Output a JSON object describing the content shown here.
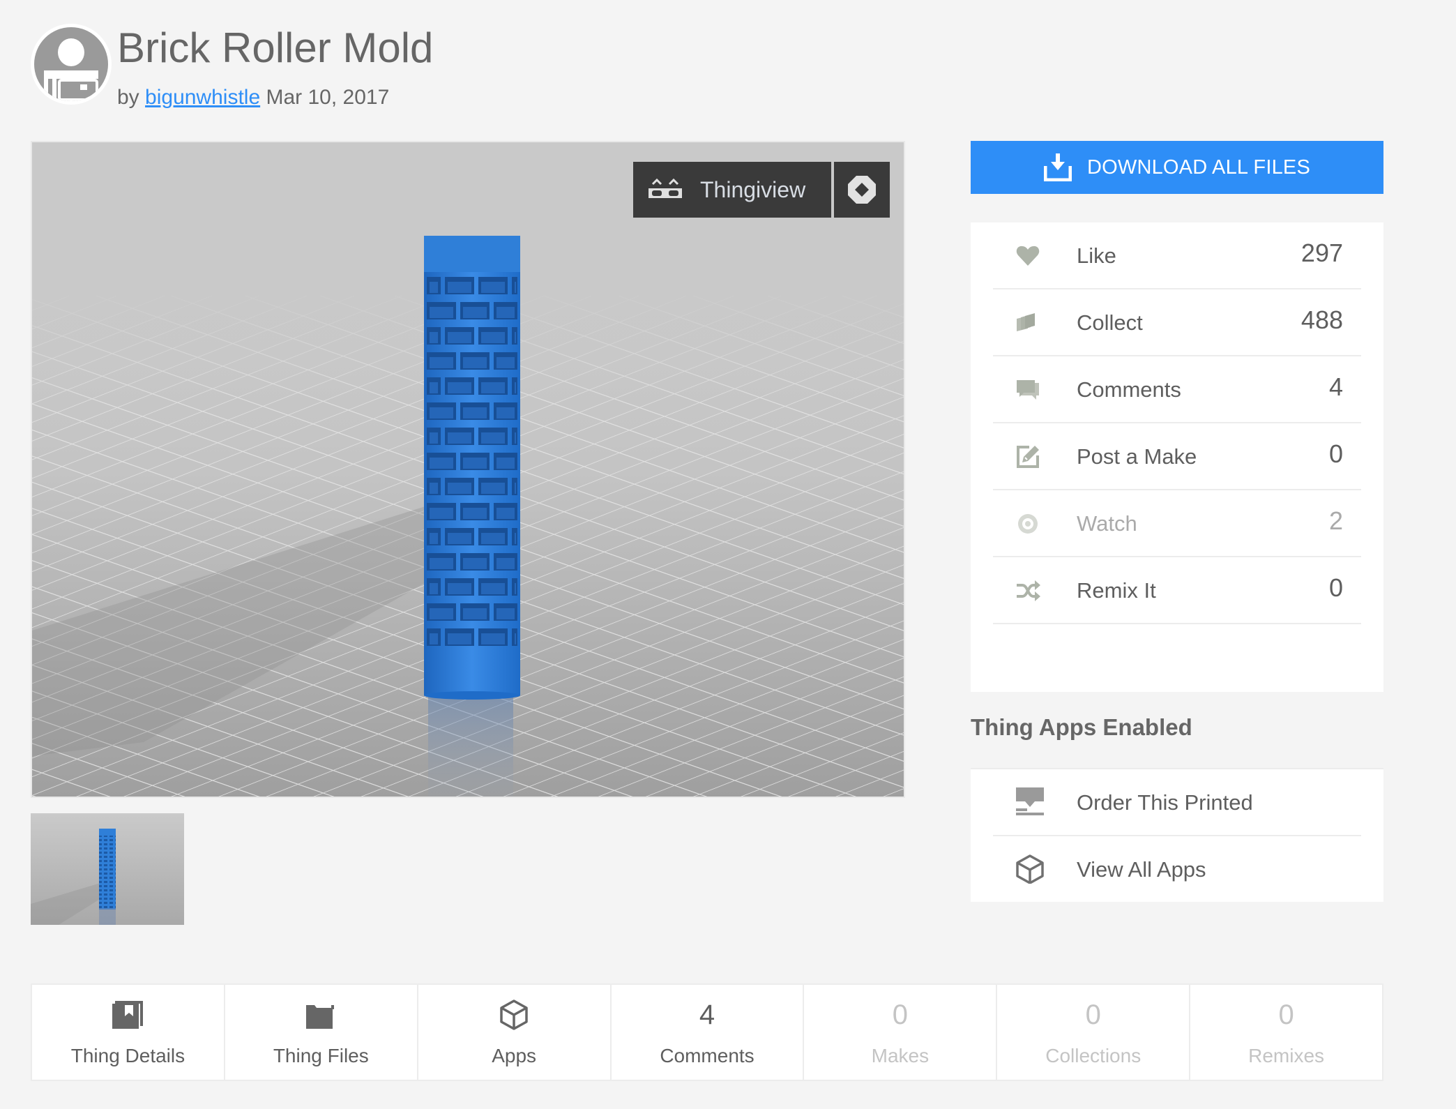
{
  "header": {
    "title": "Brick Roller Mold",
    "by_prefix": "by",
    "author": "bigunwhistle",
    "date": "Mar 10, 2017",
    "avatar_icon": "user-avatar-icon"
  },
  "viewer": {
    "thingiview_label": "Thingiview",
    "thingiview_icon": "3d-glasses-icon",
    "expand_icon": "expand-arrows-icon",
    "model_color": "#2f7fd8",
    "background_color": "#c9c9c9"
  },
  "thumbnails": [
    {
      "label": "Brick Roller Mold thumbnail",
      "selected": true
    }
  ],
  "download": {
    "label": "DOWNLOAD ALL FILES",
    "icon": "download-icon",
    "color": "#2e8ef7"
  },
  "stats": [
    {
      "icon": "heart-icon",
      "label": "Like",
      "count": "297",
      "dim": false
    },
    {
      "icon": "collect-stack-icon",
      "label": "Collect",
      "count": "488",
      "dim": false
    },
    {
      "icon": "comments-icon",
      "label": "Comments",
      "count": "4",
      "dim": false
    },
    {
      "icon": "edit-icon",
      "label": "Post a Make",
      "count": "0",
      "dim": false
    },
    {
      "icon": "eye-icon",
      "label": "Watch",
      "count": "2",
      "dim": true
    },
    {
      "icon": "shuffle-icon",
      "label": "Remix It",
      "count": "0",
      "dim": false
    }
  ],
  "apps": {
    "heading": "Thing Apps Enabled",
    "items": [
      {
        "icon": "printer-icon",
        "label": "Order This Printed"
      },
      {
        "icon": "cube-icon",
        "label": "View All Apps"
      }
    ]
  },
  "tabs": [
    {
      "icon": "book-icon",
      "count": null,
      "label": "Thing Details",
      "dim": false
    },
    {
      "icon": "folder-icon",
      "count": null,
      "label": "Thing Files",
      "dim": false
    },
    {
      "icon": "cube-icon",
      "count": null,
      "label": "Apps",
      "dim": false
    },
    {
      "icon": null,
      "count": "4",
      "label": "Comments",
      "dim": false
    },
    {
      "icon": null,
      "count": "0",
      "label": "Makes",
      "dim": true
    },
    {
      "icon": null,
      "count": "0",
      "label": "Collections",
      "dim": true
    },
    {
      "icon": null,
      "count": "0",
      "label": "Remixes",
      "dim": true
    }
  ]
}
